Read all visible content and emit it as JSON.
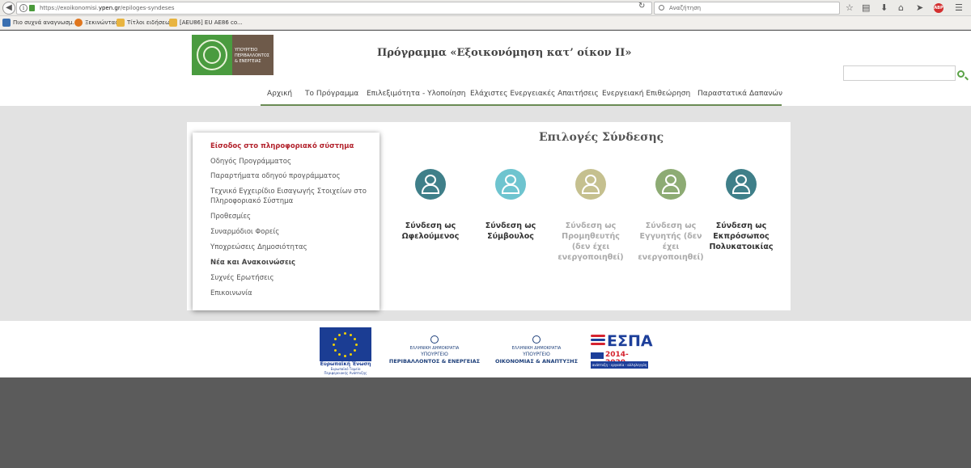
{
  "browser": {
    "url_prefix": "https://exoikonomisi.",
    "url_domain": "ypen.gr",
    "url_suffix": "/epiloges-syndeses",
    "search_placeholder": "Αναζήτηση",
    "bookmarks": [
      {
        "label": "Πιο συχνά αναγνωσμ...",
        "icon": "page-icon",
        "color": "#3a6fb0"
      },
      {
        "label": "Ξεκινώντας",
        "icon": "firefox-icon",
        "color": "#e0761e"
      },
      {
        "label": "Τίτλοι ειδήσεων",
        "icon": "rss-folder-icon",
        "color": "#e8b440"
      },
      {
        "label": "[AEU86] EU AE86 co...",
        "icon": "folder-icon",
        "color": "#e8b440"
      }
    ]
  },
  "header": {
    "logo_text_lines": [
      "ΥΠΟΥΡΓΕΙΟ",
      "ΠΕΡΙΒΑΛΛΟΝΤΟΣ",
      "& ΕΝΕΡΓΕΙΑΣ"
    ],
    "title": "Πρόγραμμα «Εξοικονόμηση κατ’ οίκον ΙΙ»",
    "menu": [
      "Αρχική",
      "Το Πρόγραμμα",
      "Επιλεξιμότητα - Υλοποίηση",
      "Ελάχιστες Ενεργειακές Απαιτήσεις",
      "Ενεργειακή Επιθεώρηση",
      "Παραστατικά Δαπανών"
    ]
  },
  "sidebar": {
    "items": [
      "Είσοδος στο πληροφοριακό σύστημα",
      "Οδηγός Προγράμματος",
      "Παραρτήματα οδηγού προγράμματος",
      "Τεχνικό Εγχειρίδιο Εισαγωγής Στοιχείων στο",
      "Πληροφοριακό Σύστημα",
      "Προθεσμίες",
      "Συναρμόδιοι Φορείς",
      "Υποχρεώσεις Δημοσιότητας",
      "Νέα και Ανακοινώσεις",
      "Συχνές Ερωτήσεις",
      "Επικοινωνία"
    ]
  },
  "connection": {
    "title": "Επιλογές Σύνδεσης",
    "options": [
      {
        "lines": [
          "Σύνδεση ως",
          "Ωφελούμενος"
        ],
        "color": "#3f7f89",
        "enabled": true
      },
      {
        "lines": [
          "Σύνδεση ως",
          "Σύμβουλος"
        ],
        "color": "#6ec4cf",
        "enabled": true
      },
      {
        "lines": [
          "Σύνδεση ως",
          "Προμηθευτής",
          "(δεν έχει",
          "ενεργοποιηθεί)"
        ],
        "color": "#c5c08f",
        "enabled": false
      },
      {
        "lines": [
          "Σύνδεση ως",
          "Εγγυητής (δεν",
          "έχει",
          "ενεργοποιηθεί)"
        ],
        "color": "#8dab74",
        "enabled": false
      },
      {
        "lines": [
          "Σύνδεση ως",
          "Εκπρόσωπος",
          "Πολυκατοικίας"
        ],
        "color": "#3f7f89",
        "enabled": true
      }
    ]
  },
  "footer": {
    "eu_title": "Ευρωπαϊκή Ένωση",
    "eu_sub": "Ευρωπαϊκό Ταμείο Περιφερειακής Ανάπτυξης",
    "gov1": [
      "ΕΛΛΗΝΙΚΗ ΔΗΜΟΚΡΑΤΙΑ",
      "ΥΠΟΥΡΓΕΙΟ",
      "ΠΕΡΙΒΑΛΛΟΝΤΟΣ & ΕΝΕΡΓΕΙΑΣ"
    ],
    "gov2": [
      "ΕΛΛΗΝΙΚΗ ΔΗΜΟΚΡΑΤΙΑ",
      "ΥΠΟΥΡΓΕΙΟ",
      "ΟΙΚΟΝΟΜΙΑΣ & ΑΝΑΠΤΥΞΗΣ"
    ],
    "espa_title": "ΕΣΠΑ",
    "espa_years": "2014-2020",
    "espa_slogan": "ανάπτυξη - εργασία - αλληλεγγύη"
  }
}
